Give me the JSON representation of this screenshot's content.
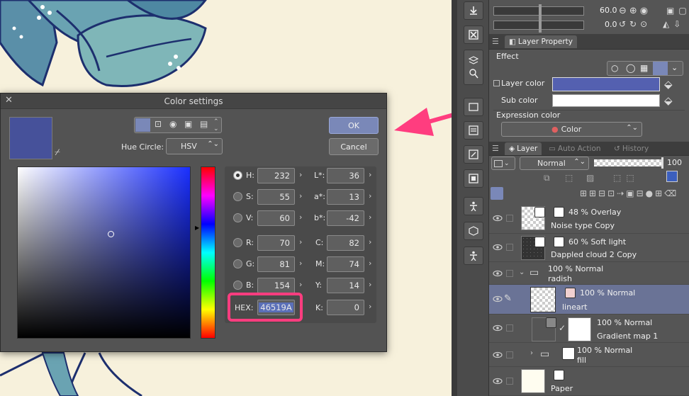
{
  "color_dialog": {
    "title": "Color settings",
    "ok_label": "OK",
    "cancel_label": "Cancel",
    "hue_circle_label": "Hue Circle:",
    "hue_circle_value": "HSV",
    "current_color": "#46519A",
    "hsv": [
      {
        "label": "H:",
        "value": "232",
        "selected": true
      },
      {
        "label": "S:",
        "value": "55"
      },
      {
        "label": "V:",
        "value": "60"
      }
    ],
    "rgb": [
      {
        "label": "R:",
        "value": "70"
      },
      {
        "label": "G:",
        "value": "81"
      },
      {
        "label": "B:",
        "value": "154"
      }
    ],
    "lab": [
      {
        "label": "L*:",
        "value": "36"
      },
      {
        "label": "a*:",
        "value": "13"
      },
      {
        "label": "b*:",
        "value": "-42"
      }
    ],
    "cmyk": [
      {
        "label": "C:",
        "value": "82"
      },
      {
        "label": "M:",
        "value": "74"
      },
      {
        "label": "Y:",
        "value": "14"
      },
      {
        "label": "K:",
        "value": "0"
      }
    ],
    "hex_label": "HEX:",
    "hex_value": "46519A"
  },
  "top_panel": {
    "opacity_value": "60.0",
    "rotation_value": "0.0"
  },
  "layer_property": {
    "tab_label": "Layer Property",
    "effect_label": "Effect",
    "layer_color_label": "Layer color",
    "sub_color_label": "Sub color",
    "layer_color": "#5460b0",
    "sub_color": "#ffffff",
    "expression_color_label": "Expression color",
    "expression_color_value": "Color"
  },
  "layer_panel": {
    "tabs": [
      "Layer",
      "Auto Action",
      "History"
    ],
    "blend_mode": "Normal",
    "opacity": "100",
    "layers": [
      {
        "line1": "48 % Overlay",
        "line2": "Noise type Copy"
      },
      {
        "line1": "60 % Soft light",
        "line2": "Dappled cloud 2 Copy"
      },
      {
        "line1": "100 % Normal",
        "line2": "radish"
      },
      {
        "line1": "100 % Normal",
        "line2": "lineart"
      },
      {
        "line1": "100 % Normal",
        "line2": "Gradient map 1"
      },
      {
        "line1": "100 % Normal",
        "line2": "fill"
      },
      {
        "line1": "",
        "line2": "Paper"
      }
    ]
  },
  "colors": {
    "accent": "#ff3d7f",
    "selected_layer": "#6a7396"
  }
}
